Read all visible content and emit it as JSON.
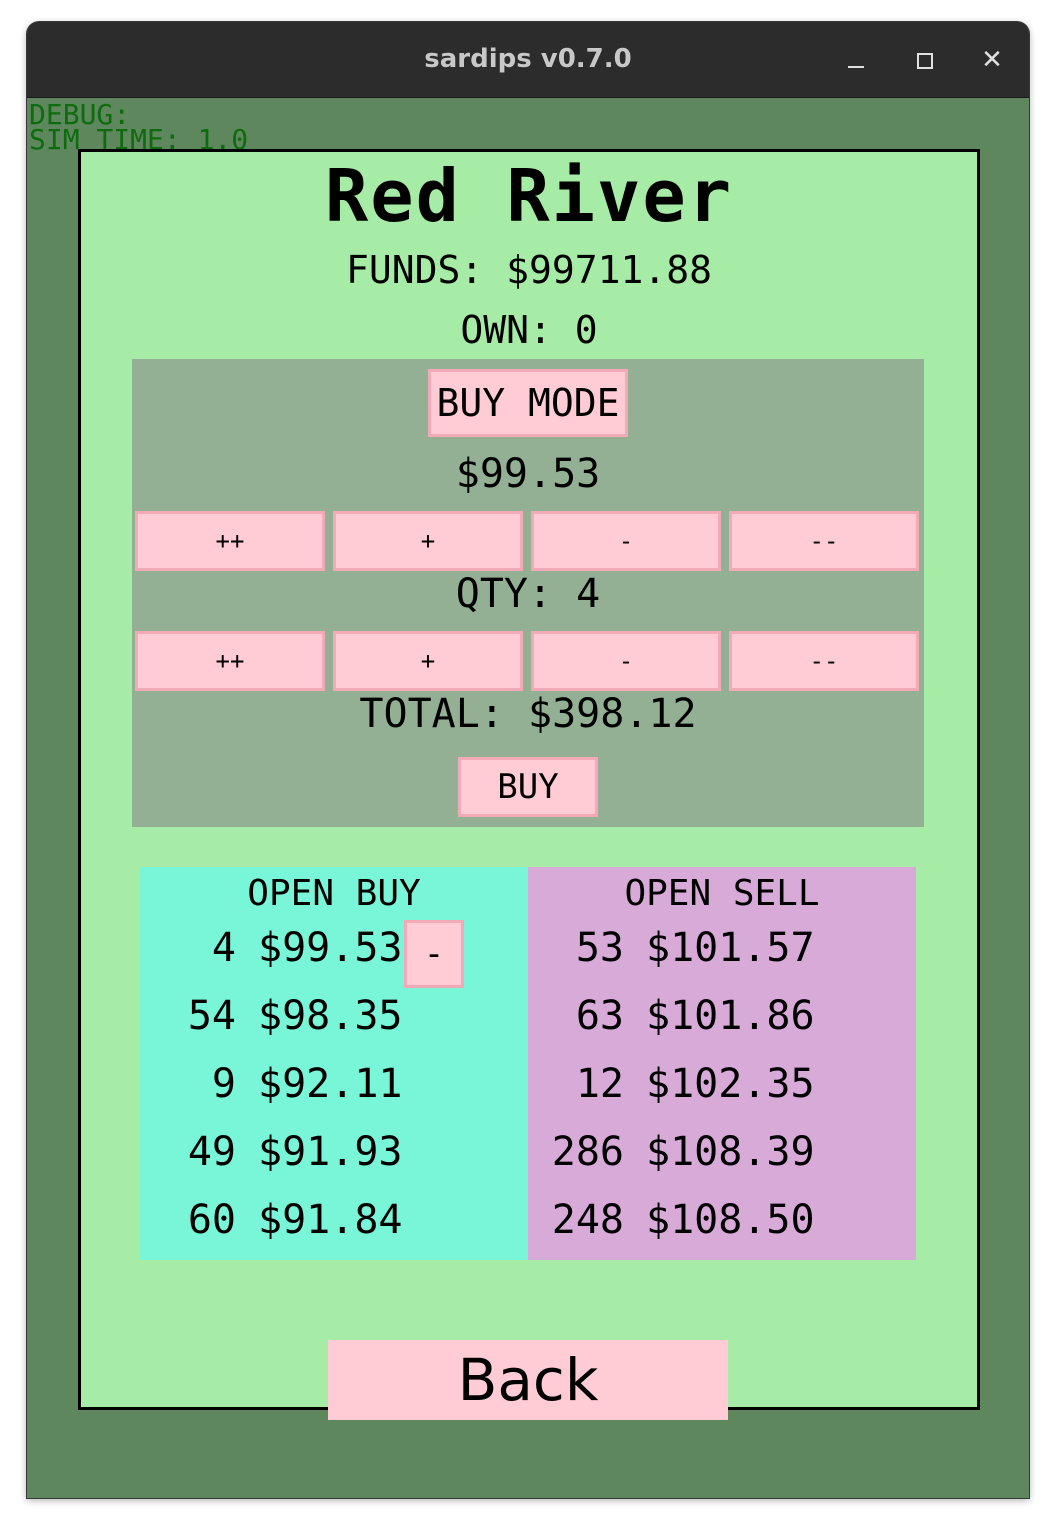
{
  "window": {
    "title": "sardips v0.7.0"
  },
  "debug": {
    "line1": "DEBUG:",
    "line2": "SIM_TIME: 1.0"
  },
  "market": {
    "name": "Red River",
    "funds": "FUNDS: $99711.88",
    "own": "OWN: 0"
  },
  "order": {
    "mode_label": "BUY MODE",
    "price": "$99.53",
    "price_steps": [
      "++",
      "+",
      "-",
      "--"
    ],
    "qty": "QTY: 4",
    "qty_steps": [
      "++",
      "+",
      "-",
      "--"
    ],
    "total": "TOTAL: $398.12",
    "action_label": "BUY"
  },
  "open_buy": {
    "heading": "OPEN BUY",
    "cancel_label": "-",
    "rows": [
      {
        "qty": "4",
        "price": "$99.53"
      },
      {
        "qty": "54",
        "price": "$98.35"
      },
      {
        "qty": "9",
        "price": "$92.11"
      },
      {
        "qty": "49",
        "price": "$91.93"
      },
      {
        "qty": "60",
        "price": "$91.84"
      }
    ]
  },
  "open_sell": {
    "heading": "OPEN SELL",
    "rows": [
      {
        "qty": "53",
        "price": "$101.57"
      },
      {
        "qty": "63",
        "price": "$101.86"
      },
      {
        "qty": "12",
        "price": "$102.35"
      },
      {
        "qty": "286",
        "price": "$108.39"
      },
      {
        "qty": "248",
        "price": "$108.50"
      }
    ]
  },
  "back_label": "Back"
}
